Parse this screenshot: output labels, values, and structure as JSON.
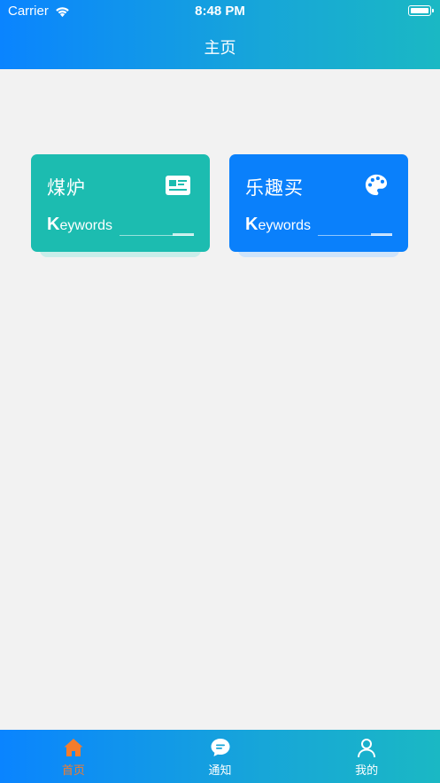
{
  "status_bar": {
    "carrier": "Carrier",
    "time": "8:48 PM",
    "icons": [
      "wifi-icon",
      "battery-icon"
    ]
  },
  "header": {
    "title": "主页"
  },
  "cards": [
    {
      "title": "煤炉",
      "keyword_initial": "K",
      "keyword_rest": "eywords",
      "icon": "newspaper-icon",
      "color": "#1cbcb0"
    },
    {
      "title": "乐趣买",
      "keyword_initial": "K",
      "keyword_rest": "eywords",
      "icon": "palette-icon",
      "color": "#0a80fb"
    }
  ],
  "tabbar": {
    "tabs": [
      {
        "label": "首页",
        "icon": "home-icon",
        "active": true
      },
      {
        "label": "通知",
        "icon": "chat-bubble-icon",
        "active": false
      },
      {
        "label": "我的",
        "icon": "user-icon",
        "active": false
      }
    ],
    "active_color": "#f47c2c"
  },
  "colors": {
    "header_gradient_start": "#0a84ff",
    "header_gradient_end": "#1ab8c4",
    "background": "#f2f2f2"
  }
}
